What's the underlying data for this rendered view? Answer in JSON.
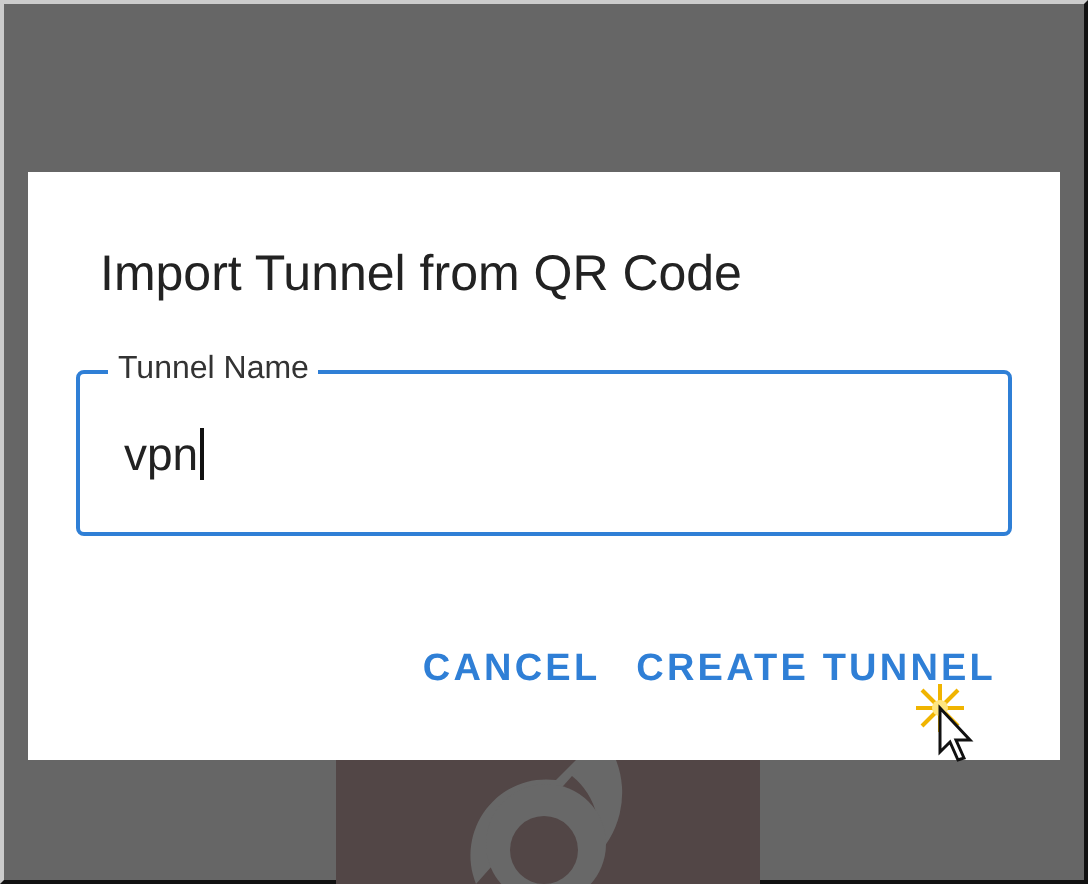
{
  "dialog": {
    "title": "Import Tunnel from QR Code",
    "field": {
      "label": "Tunnel Name",
      "value": "vpn",
      "focused": true
    },
    "buttons": [
      "CANCEL",
      "CREATE TUNNEL"
    ]
  }
}
